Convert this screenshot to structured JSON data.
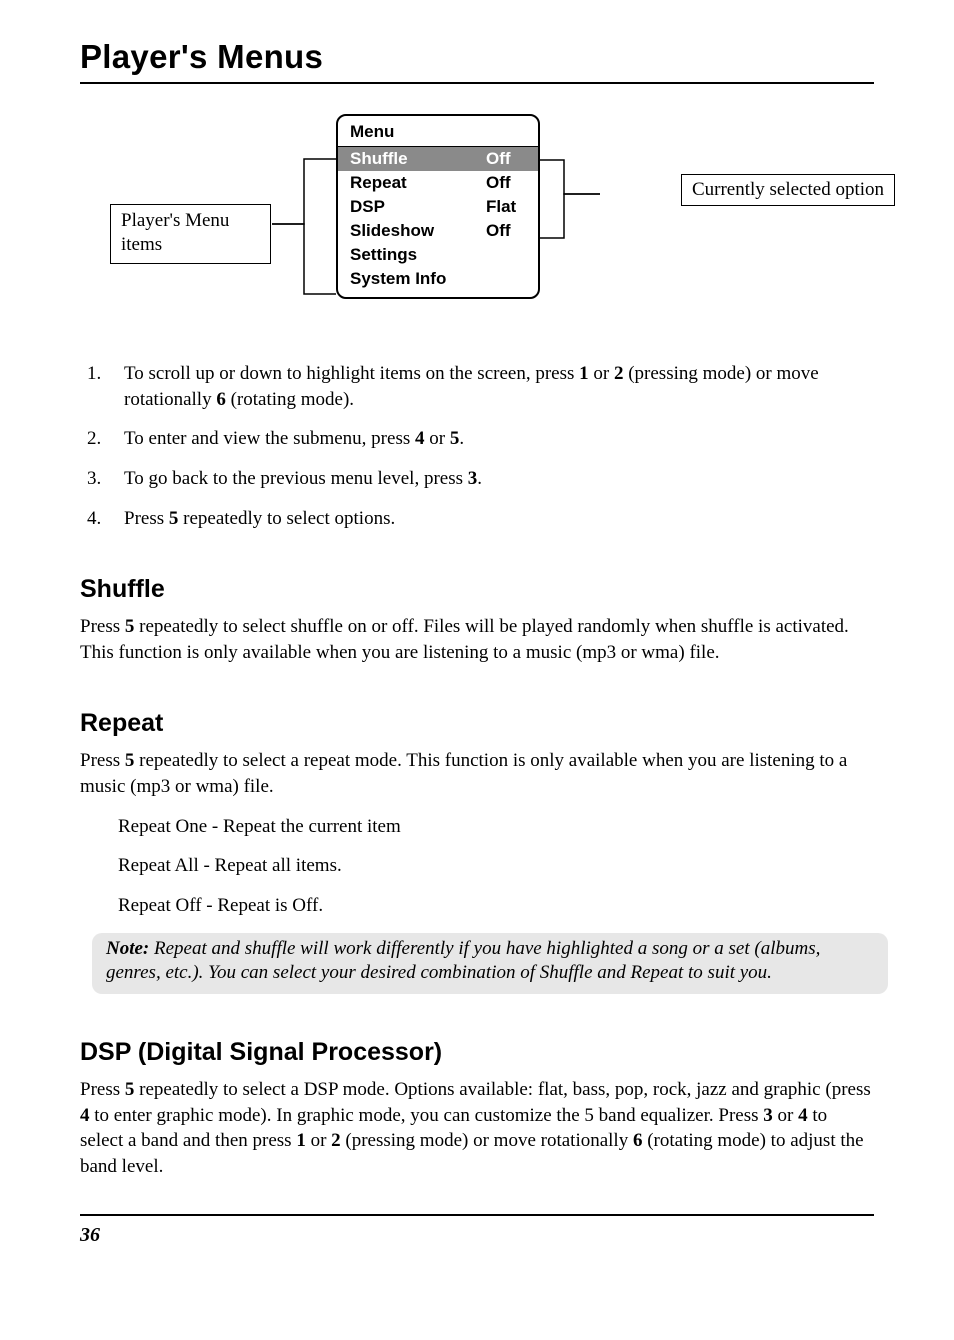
{
  "page": {
    "title": "Player's Menus",
    "number": "36"
  },
  "diagram": {
    "left_callout": "Player's Menu items",
    "right_callout": "Currently selected option",
    "menu_header": "Menu",
    "rows": [
      {
        "label": "Shuffle",
        "value": "Off",
        "highlight": true
      },
      {
        "label": "Repeat",
        "value": "Off",
        "highlight": false
      },
      {
        "label": "DSP",
        "value": "Flat",
        "highlight": false
      },
      {
        "label": "Slideshow",
        "value": "Off",
        "highlight": false
      },
      {
        "label": "Settings",
        "value": "",
        "highlight": false
      },
      {
        "label": "System Info",
        "value": "",
        "highlight": false
      }
    ]
  },
  "steps": {
    "s1_a": "To scroll up or down to highlight items on the screen, press ",
    "s1_b": " or ",
    "s1_c": " (pressing mode) or move rotationally ",
    "s1_d": " (rotating mode).",
    "s1_n1": "1",
    "s1_n2": "2",
    "s1_n3": "6",
    "s2_a": "To enter and view the submenu, press ",
    "s2_b": " or ",
    "s2_c": ".",
    "s2_n1": "4",
    "s2_n2": "5",
    "s3_a": "To go back to the previous menu level, press ",
    "s3_b": ".",
    "s3_n1": "3",
    "s4_a": "Press ",
    "s4_b": " repeatedly to select options.",
    "s4_n1": "5"
  },
  "sections": {
    "shuffle": {
      "heading": "Shuffle",
      "p_a": "Press ",
      "p_n1": "5",
      "p_b": " repeatedly to select shuffle on or off. Files will be played randomly when shuffle is activated. This function is only available when you are listening to a music (mp3 or wma) file."
    },
    "repeat": {
      "heading": "Repeat",
      "p_a": "Press ",
      "p_n1": "5",
      "p_b": " repeatedly to select a repeat mode. This function is only available when you are listening to a music (mp3 or wma) file.",
      "items": {
        "one": "Repeat One - Repeat the current item",
        "all": "Repeat All - Repeat all items.",
        "off": "Repeat Off - Repeat is Off."
      },
      "note_label": "Note:",
      "note_body": " Repeat and shuffle will work differently if you have highlighted a song or a set (albums, genres, etc.). You can select your desired combination of Shuffle and Repeat to suit you."
    },
    "dsp": {
      "heading": "DSP (Digital Signal Processor)",
      "p_a": "Press ",
      "p_n1": "5",
      "p_b": " repeatedly to select a DSP mode. Options available: flat, bass, pop, rock, jazz and graphic (press ",
      "p_n2": "4",
      "p_c": " to enter graphic mode). In graphic mode, you can customize the 5 band equalizer. Press ",
      "p_n3": "3",
      "p_d": " or ",
      "p_n4": "4",
      "p_e": " to select a band and then press ",
      "p_n5": "1",
      "p_f": " or ",
      "p_n6": "2",
      "p_g": " (pressing mode) or move rotationally ",
      "p_n7": "6",
      "p_h": " (rotating mode) to adjust the band level."
    }
  }
}
